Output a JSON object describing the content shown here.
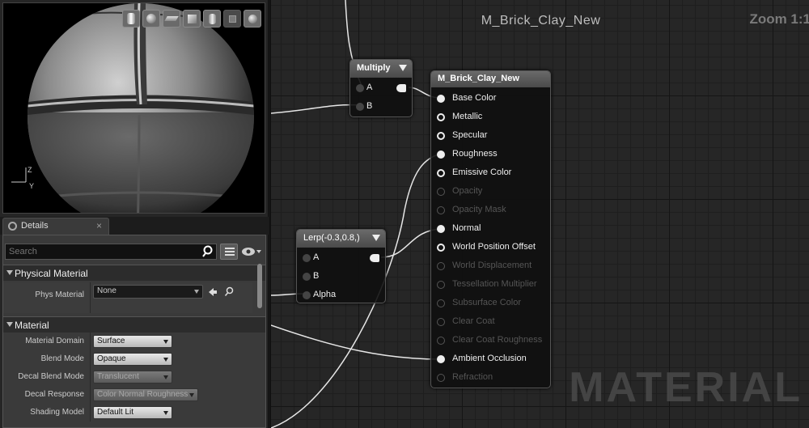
{
  "viewport": {
    "toolbar": [
      "sphere-preview",
      "sphere-lit",
      "plane-preview",
      "cube-preview",
      "cylinder-preview",
      "custom-mesh",
      "realtime-toggle"
    ],
    "axis": {
      "z": "Z",
      "y": "Y"
    }
  },
  "details": {
    "tab_label": "Details",
    "close": "×",
    "search_placeholder": "Search",
    "categories": [
      {
        "label": "Physical Material"
      },
      {
        "label": "Material"
      }
    ],
    "properties": {
      "phys_material": {
        "label": "Phys Material",
        "value": "None"
      },
      "material_domain": {
        "label": "Material Domain",
        "value": "Surface"
      },
      "blend_mode": {
        "label": "Blend Mode",
        "value": "Opaque"
      },
      "decal_blend_mode": {
        "label": "Decal Blend Mode",
        "value": "Translucent"
      },
      "decal_response": {
        "label": "Decal Response",
        "value": "Color Normal Roughness"
      },
      "shading_model": {
        "label": "Shading Model",
        "value": "Default Lit"
      }
    }
  },
  "graph": {
    "title": "M_Brick_Clay_New",
    "zoom": "Zoom 1:1",
    "watermark": "MATERIAL",
    "multiply_node": {
      "title": "Multiply",
      "pins": [
        "A",
        "B"
      ]
    },
    "lerp_node": {
      "title": "Lerp(-0.3,0.8,)",
      "pins": [
        "A",
        "B",
        "Alpha"
      ]
    },
    "material_node": {
      "title": "M_Brick_Clay_New",
      "pins": [
        {
          "label": "Base Color",
          "state": "connected"
        },
        {
          "label": "Metallic",
          "state": "open"
        },
        {
          "label": "Specular",
          "state": "open"
        },
        {
          "label": "Roughness",
          "state": "connected"
        },
        {
          "label": "Emissive Color",
          "state": "open"
        },
        {
          "label": "Opacity",
          "state": "disabled"
        },
        {
          "label": "Opacity Mask",
          "state": "disabled"
        },
        {
          "label": "Normal",
          "state": "connected"
        },
        {
          "label": "World Position Offset",
          "state": "open"
        },
        {
          "label": "World Displacement",
          "state": "disabled"
        },
        {
          "label": "Tessellation Multiplier",
          "state": "disabled"
        },
        {
          "label": "Subsurface Color",
          "state": "disabled"
        },
        {
          "label": "Clear Coat",
          "state": "disabled"
        },
        {
          "label": "Clear Coat Roughness",
          "state": "disabled"
        },
        {
          "label": "Ambient Occlusion",
          "state": "connected"
        },
        {
          "label": "Refraction",
          "state": "disabled"
        }
      ]
    }
  }
}
